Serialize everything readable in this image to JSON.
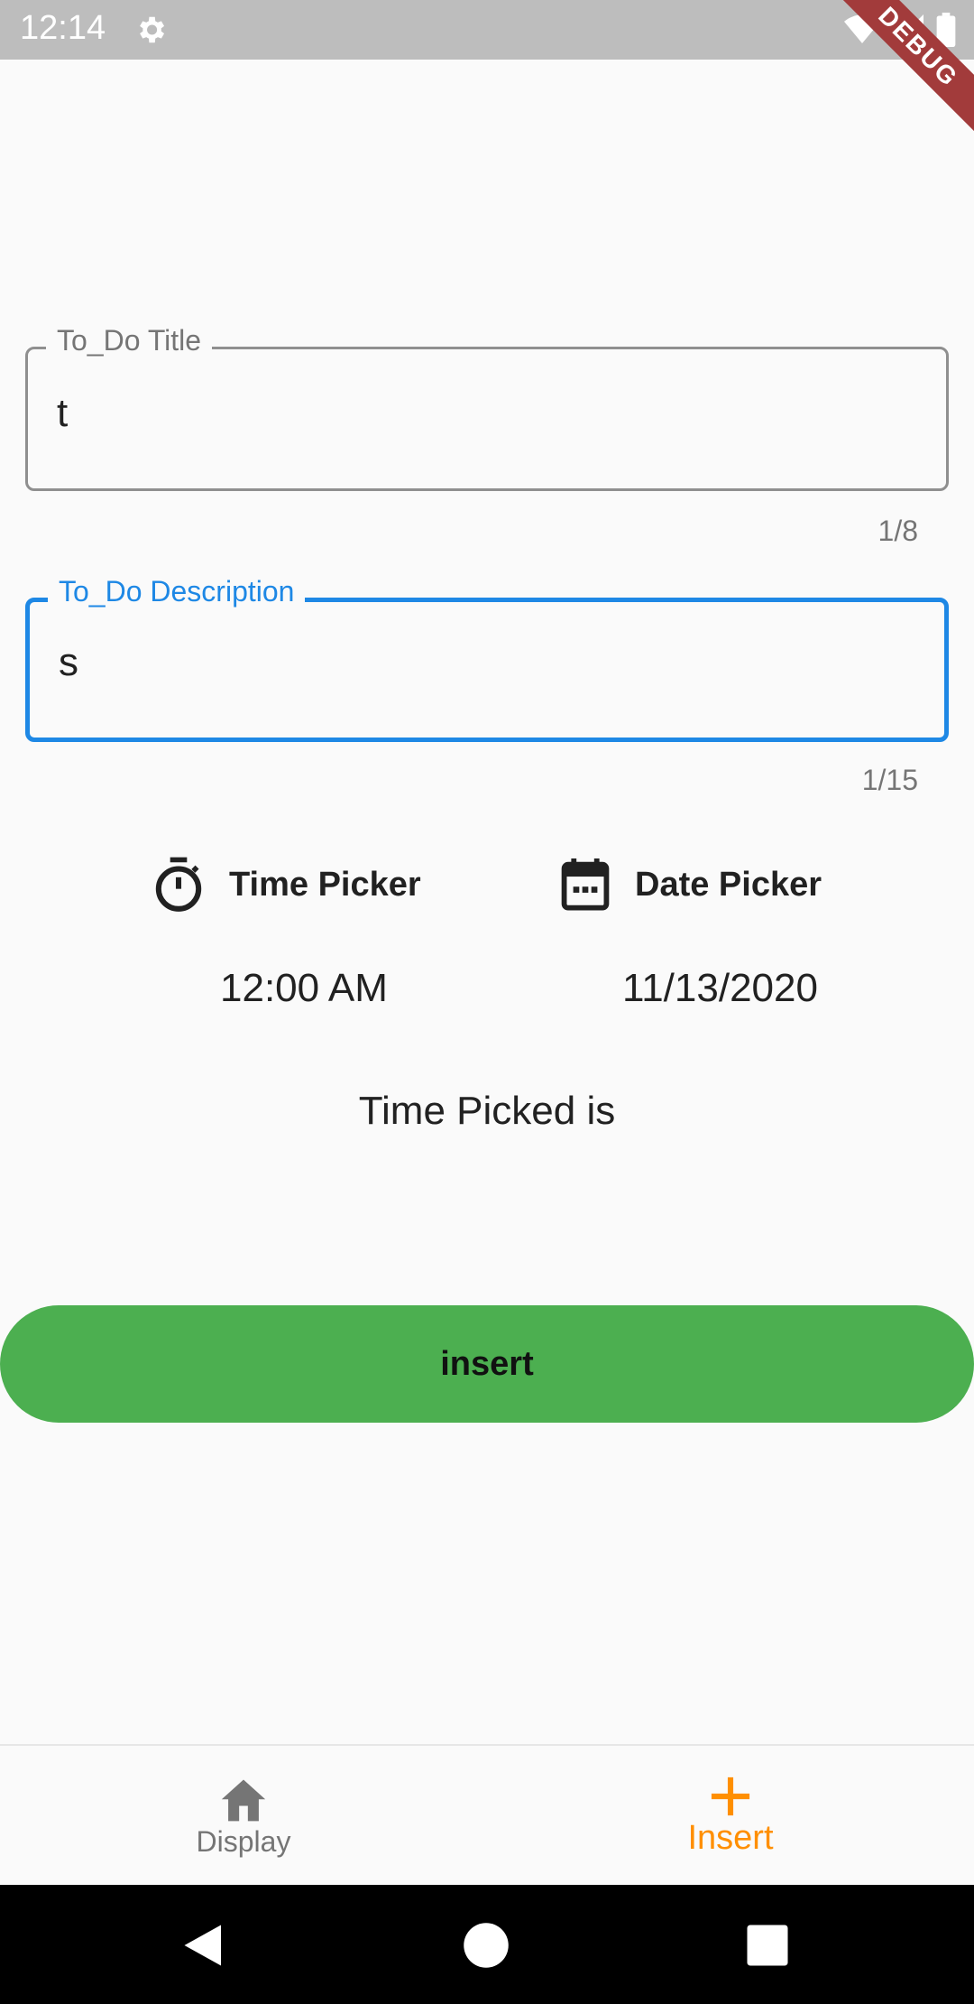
{
  "status_bar": {
    "time": "12:14",
    "debug_label": "DEBUG"
  },
  "form": {
    "title_field": {
      "label": "To_Do Title",
      "value": "t",
      "counter": "1/8"
    },
    "description_field": {
      "label": "To_Do Description",
      "value": "s",
      "counter": "1/15"
    }
  },
  "pickers": {
    "time_picker_label": "Time Picker",
    "date_picker_label": "Date Picker",
    "selected_time": "12:00 AM",
    "selected_date": "11/13/2020"
  },
  "time_picked_text": "Time Picked is",
  "insert_button_label": "insert",
  "bottom_nav": {
    "items": [
      {
        "label": "Display",
        "icon": "home-icon",
        "active": false
      },
      {
        "label": "Insert",
        "icon": "plus-icon",
        "active": true
      }
    ]
  },
  "colors": {
    "accent_blue": "#1e88e5",
    "button_green": "#4caf50",
    "nav_active_orange": "#ff8f00",
    "debug_ribbon": "#a23b3b"
  }
}
